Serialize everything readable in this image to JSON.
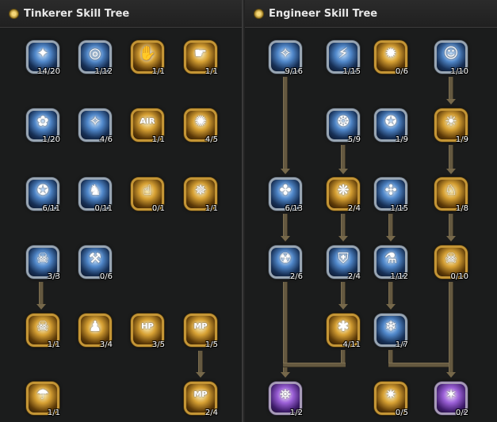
{
  "tinkerer": {
    "title": "Tinkerer Skill Tree",
    "skills": [
      {
        "level": "14/20",
        "icon": "✦",
        "style": "blue"
      },
      {
        "level": "1/12",
        "icon": "◎",
        "style": "blue"
      },
      {
        "level": "1/1",
        "icon": "✋",
        "style": "gold"
      },
      {
        "level": "1/1",
        "icon": "☛",
        "style": "gold"
      },
      {
        "level": "1/20",
        "icon": "✿",
        "style": "blue"
      },
      {
        "level": "4/6",
        "icon": "✧",
        "style": "blue"
      },
      {
        "level": "1/1",
        "icon": "AIR",
        "style": "gold"
      },
      {
        "level": "4/5",
        "icon": "✺",
        "style": "gold"
      },
      {
        "level": "6/11",
        "icon": "✪",
        "style": "blue"
      },
      {
        "level": "0/11",
        "icon": "♞",
        "style": "blue"
      },
      {
        "level": "0/1",
        "icon": "☝",
        "style": "gold"
      },
      {
        "level": "1/1",
        "icon": "✵",
        "style": "gold"
      },
      {
        "level": "3/3",
        "icon": "☠",
        "style": "blue"
      },
      {
        "level": "0/6",
        "icon": "⚒",
        "style": "blue"
      },
      {
        "level": "1/1",
        "icon": "☠",
        "style": "gold"
      },
      {
        "level": "3/4",
        "icon": "♟",
        "style": "gold"
      },
      {
        "level": "3/5",
        "icon": "HP",
        "style": "gold"
      },
      {
        "level": "1/5",
        "icon": "MP",
        "style": "gold"
      },
      {
        "level": "1/1",
        "icon": "☂",
        "style": "gold"
      },
      {
        "level": "2/4",
        "icon": "MP",
        "style": "gold"
      }
    ]
  },
  "engineer": {
    "title": "Engineer Skill Tree",
    "skills": [
      {
        "level": "9/16",
        "icon": "✧",
        "style": "blue"
      },
      {
        "level": "1/15",
        "icon": "⚡",
        "style": "blue"
      },
      {
        "level": "0/6",
        "icon": "✹",
        "style": "gold"
      },
      {
        "level": "1/10",
        "icon": "☺",
        "style": "blue"
      },
      {
        "level": "5/9",
        "icon": "❂",
        "style": "blue"
      },
      {
        "level": "1/9",
        "icon": "✪",
        "style": "blue"
      },
      {
        "level": "1/9",
        "icon": "☀",
        "style": "gold"
      },
      {
        "level": "6/13",
        "icon": "✤",
        "style": "blue"
      },
      {
        "level": "2/4",
        "icon": "❋",
        "style": "gold"
      },
      {
        "level": "1/15",
        "icon": "✣",
        "style": "blue"
      },
      {
        "level": "1/8",
        "icon": "♘",
        "style": "gold"
      },
      {
        "level": "2/6",
        "icon": "☢",
        "style": "blue"
      },
      {
        "level": "2/4",
        "icon": "⛨",
        "style": "blue"
      },
      {
        "level": "1/12",
        "icon": "⚗",
        "style": "blue"
      },
      {
        "level": "0/10",
        "icon": "☠",
        "style": "gold"
      },
      {
        "level": "4/11",
        "icon": "✱",
        "style": "gold"
      },
      {
        "level": "1/7",
        "icon": "❄",
        "style": "blue"
      },
      {
        "level": "1/2",
        "icon": "⛯",
        "style": "purple"
      },
      {
        "level": "0/5",
        "icon": "✷",
        "style": "gold"
      },
      {
        "level": "0/2",
        "icon": "✶",
        "style": "purple"
      }
    ]
  }
}
